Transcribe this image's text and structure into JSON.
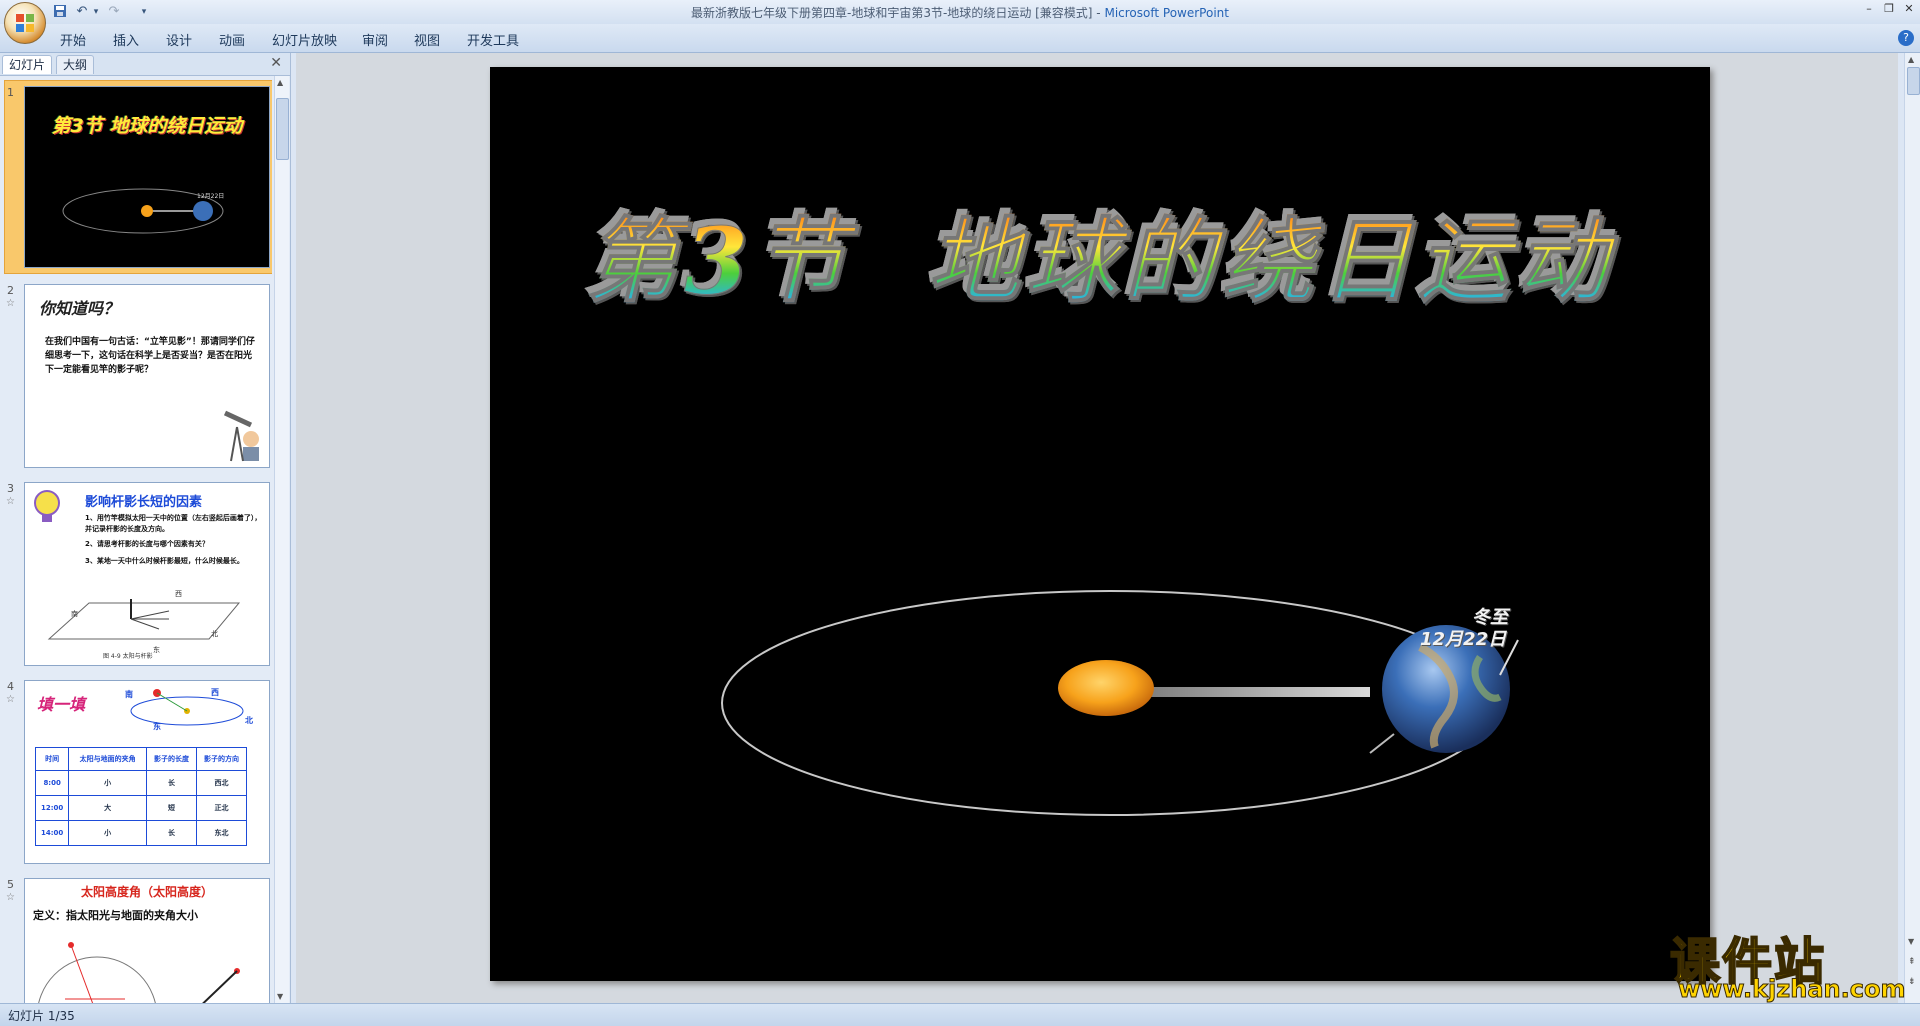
{
  "window": {
    "title": "最新浙教版七年级下册第四章-地球和宇宙第3节-地球的绕日运动 [兼容模式] -",
    "app_name": "Microsoft PowerPoint"
  },
  "ribbon": {
    "tabs": [
      "开始",
      "插入",
      "设计",
      "动画",
      "幻灯片放映",
      "审阅",
      "视图",
      "开发工具"
    ]
  },
  "left_pane": {
    "tabs": [
      "幻灯片",
      "大纲"
    ],
    "thumbnails": [
      {
        "num": "1",
        "title": "第3节 地球的绕日运动",
        "label": "12月22日"
      },
      {
        "num": "2",
        "title": "你知道吗？",
        "body": "在我们中国有一句古话：“立竿见影”！那请同学们仔细思考一下，这句话在科学上是否妥当？是否在阳光下一定能看见竿的影子呢？"
      },
      {
        "num": "3",
        "title": "影响杆影长短的因素",
        "items": [
          "1、用竹竿模拟太阳一天中的位置（左右竖起后画着了），并记录杆影的长度及方向。",
          "2、请思考杆影的长度与哪个因素有关？",
          "3、某地一天中什么时候杆影最短，什么时候最长。"
        ],
        "caption": "图 4-9  太阳与杆影",
        "directions": [
          "西",
          "南",
          "东",
          "北"
        ]
      },
      {
        "num": "4",
        "title": "填一填",
        "directions": [
          "南",
          "西",
          "东",
          "北"
        ],
        "table_headers": [
          "时间",
          "太阳与地面的夹角",
          "影子的长度",
          "影子的方向"
        ],
        "table_rows": [
          [
            "8:00",
            "小",
            "长",
            "西北"
          ],
          [
            "12:00",
            "大",
            "短",
            "正北"
          ],
          [
            "14:00",
            "小",
            "长",
            "东北"
          ]
        ]
      },
      {
        "num": "5",
        "title": "太阳高度角（太阳高度）",
        "definition": "定义：指太阳光与地面的夹角大小"
      }
    ]
  },
  "slide": {
    "title": "第3节  地球的绕日运动",
    "label_season": "冬至",
    "label_date": "12月22日"
  },
  "status": {
    "slide_counter": "幻灯片 1/35"
  },
  "watermark": {
    "text": "课件站",
    "url": "www.kjzhan.com"
  }
}
